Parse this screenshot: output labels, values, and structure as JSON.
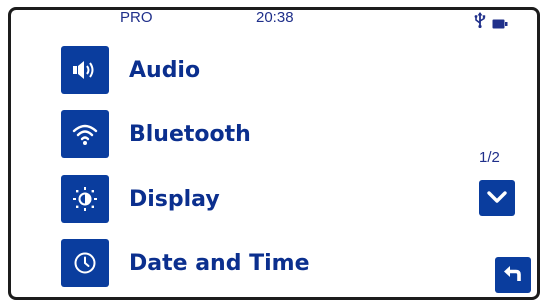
{
  "status_bar": {
    "mode": "PRO",
    "time": "20:38",
    "usb_icon": "usb-icon",
    "battery_icon": "battery-icon"
  },
  "menu": {
    "items": [
      {
        "label": "Audio",
        "icon": "speaker-icon"
      },
      {
        "label": "Bluetooth",
        "icon": "wireless-icon"
      },
      {
        "label": "Display",
        "icon": "brightness-icon"
      },
      {
        "label": "Date and Time",
        "icon": "clock-icon"
      }
    ]
  },
  "pagination": {
    "indicator": "1/2",
    "next_icon": "chevron-down-icon"
  },
  "navigation": {
    "back_icon": "back-arrow-icon"
  },
  "colors": {
    "accent": "#0a3d9e",
    "label_text": "#0b2f8e",
    "status_text": "#1f2f8a",
    "frame": "#1c1c1c"
  }
}
